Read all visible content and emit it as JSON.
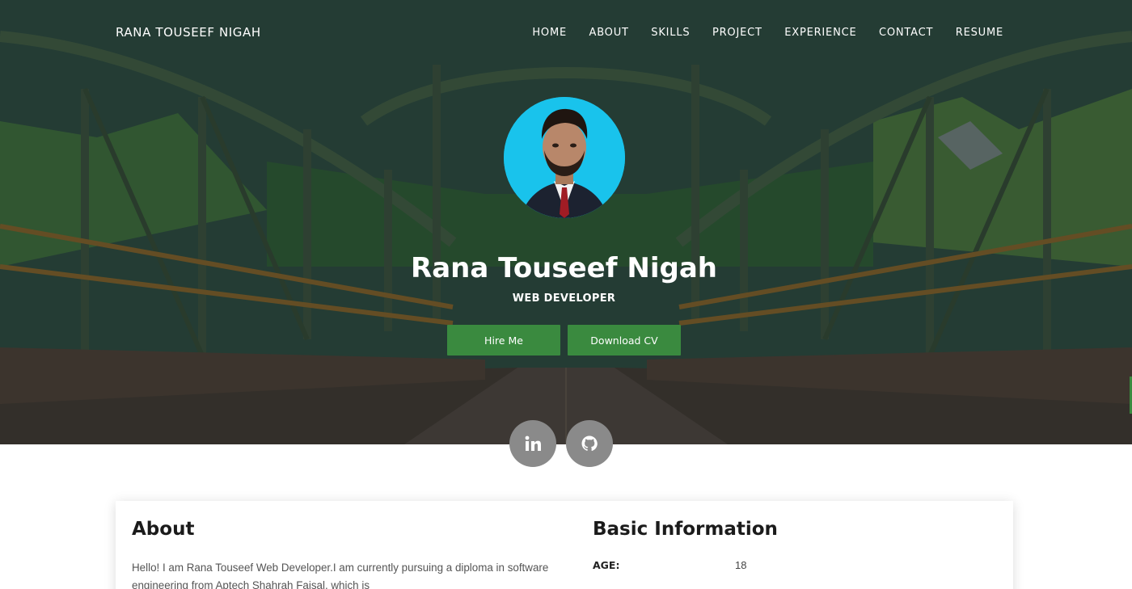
{
  "nav": {
    "brand": "RANA TOUSEEF NIGAH",
    "links": [
      "HOME",
      "ABOUT",
      "SKILLS",
      "PROJECT",
      "EXPERIENCE",
      "CONTACT",
      "RESUME"
    ]
  },
  "hero": {
    "name": "Rana Touseef Nigah",
    "role": "WEB DEVELOPER",
    "hire_label": "Hire Me",
    "cv_label": "Download CV"
  },
  "social": {
    "linkedin_icon": "linkedin-icon",
    "github_icon": "github-icon"
  },
  "about": {
    "title": "About",
    "text": "Hello! I am Rana Touseef Web Developer.I am currently pursuing a diploma in software engineering from Aptech Shahrah Faisal, which is"
  },
  "basic_info": {
    "title": "Basic Information",
    "rows": [
      {
        "label": "AGE:",
        "value": "18"
      }
    ]
  },
  "colors": {
    "accent": "#3a8a3f",
    "social_bg": "#8a8a8a",
    "avatar_bg": "#19c3ec"
  }
}
